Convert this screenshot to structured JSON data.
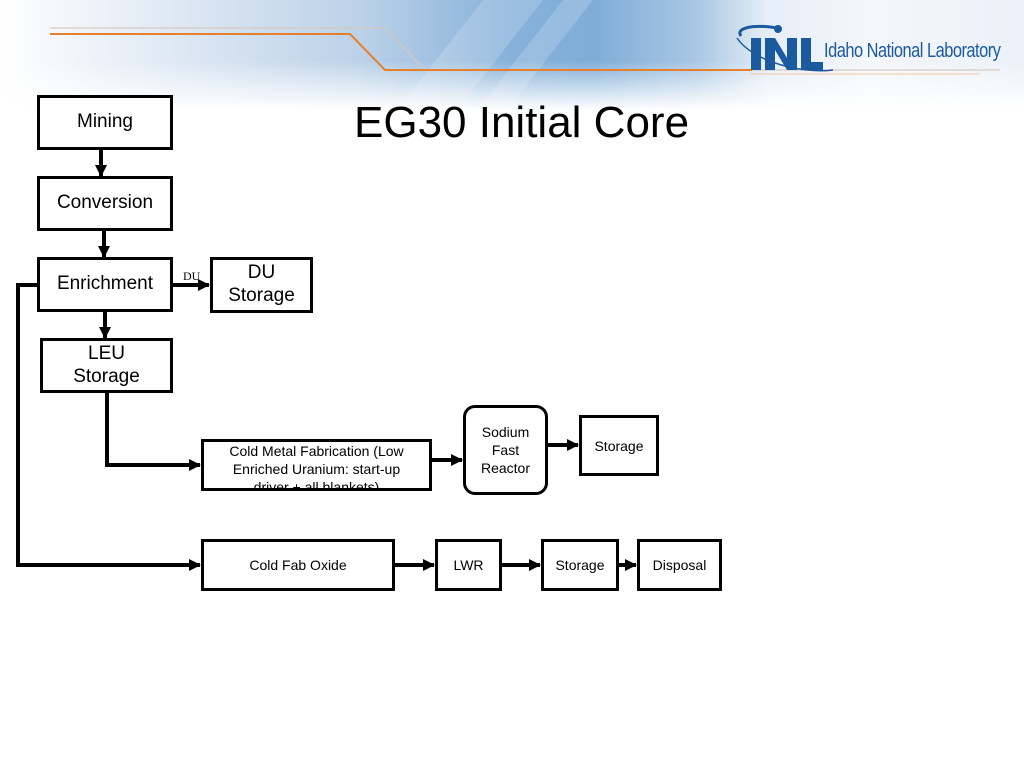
{
  "slide": {
    "title": "EG30 Initial Core",
    "logo": {
      "mark": "INL",
      "text": "Idaho National Laboratory",
      "brand_color": "#1c5aa0",
      "accent_line_color": "#e87f2c"
    }
  },
  "diagram": {
    "nodes": {
      "mining": "Mining",
      "conversion": "Conversion",
      "enrichment": "Enrichment",
      "du_storage": "DU Storage",
      "leu_storage": "LEU Storage",
      "cold_metal_fab": "Cold Metal Fabrication (Low Enriched Uranium: start-up driver + all blankets)",
      "sfr": "Sodium Fast Reactor",
      "sfr_storage": "Storage",
      "cold_fab_oxide": "Cold Fab Oxide",
      "lwr": "LWR",
      "lwr_storage": "Storage",
      "disposal": "Disposal"
    },
    "edge_labels": {
      "enrichment_to_du": "DU"
    },
    "edges": [
      [
        "mining",
        "conversion"
      ],
      [
        "conversion",
        "enrichment"
      ],
      [
        "enrichment",
        "du_storage"
      ],
      [
        "enrichment",
        "leu_storage"
      ],
      [
        "leu_storage",
        "cold_metal_fab"
      ],
      [
        "cold_metal_fab",
        "sfr"
      ],
      [
        "sfr",
        "sfr_storage"
      ],
      [
        "enrichment",
        "cold_fab_oxide"
      ],
      [
        "cold_fab_oxide",
        "lwr"
      ],
      [
        "lwr",
        "lwr_storage"
      ],
      [
        "lwr_storage",
        "disposal"
      ]
    ]
  }
}
